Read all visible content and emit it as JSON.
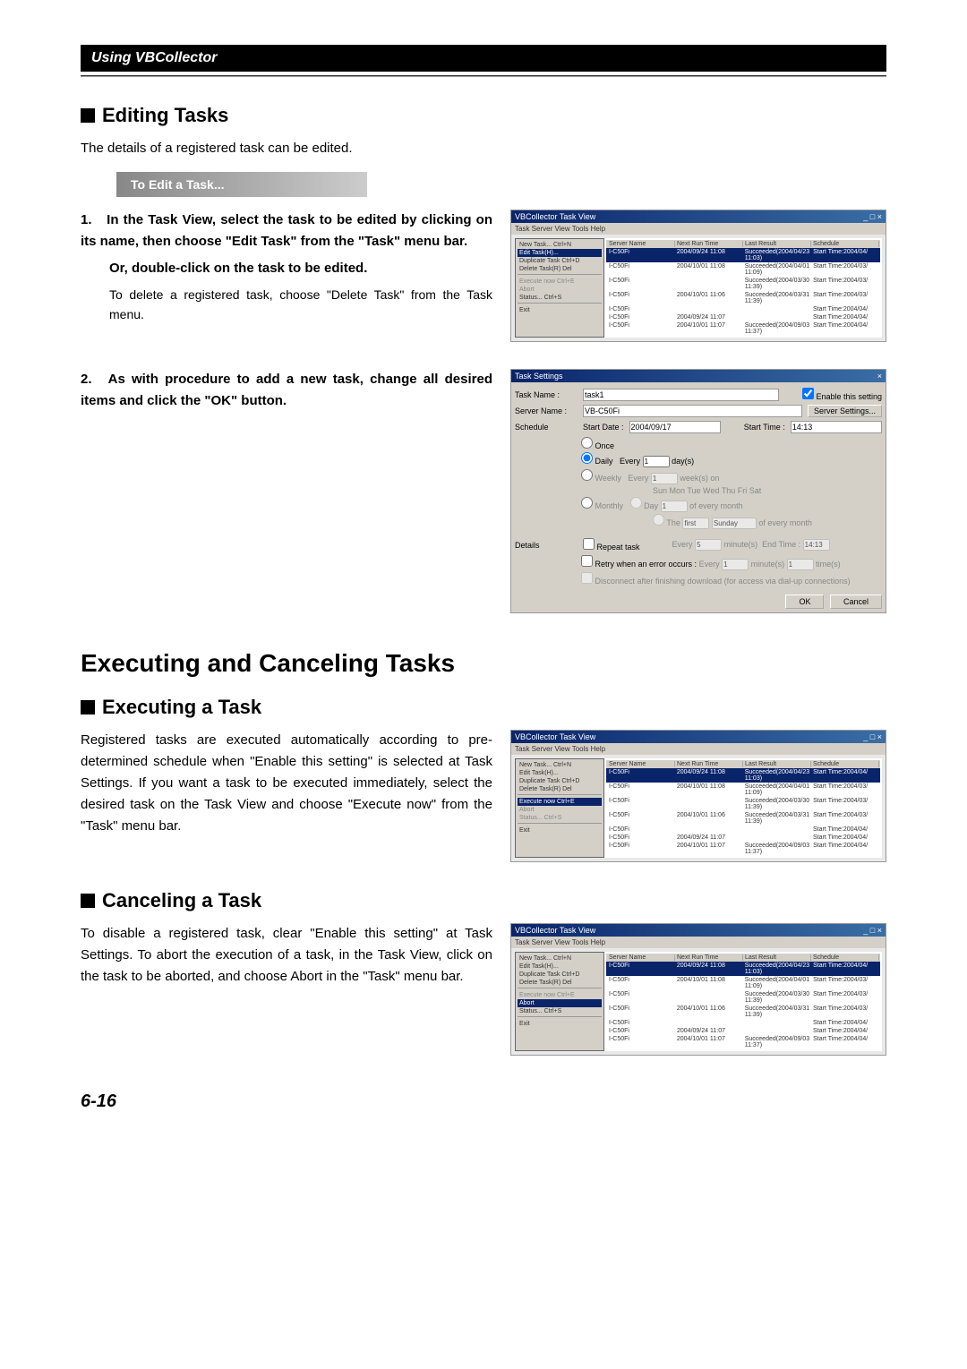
{
  "header": {
    "title": "Using VBCollector"
  },
  "editing": {
    "heading": "Editing Tasks",
    "intro": "The details of a registered task can be edited.",
    "sub_bar": "To Edit a Task...",
    "step1_text": "In the Task View, select the task to be edited by clicking on its name, then choose \"Edit Task\" from the \"Task\" menu bar.",
    "step1_sub": "Or, double-click on the task to be edited.",
    "step1_desc": "To delete a registered task, choose \"Delete Task\" from the Task menu.",
    "step2_text": "As with procedure to add a new task, change all desired items and click the \"OK\" button."
  },
  "exec_heading": "Executing and Canceling Tasks",
  "executing": {
    "heading": "Executing a Task",
    "body": "Registered tasks are executed automatically according to pre-determined schedule when \"Enable this setting\" is selected at Task Settings. If you want a task to be executed immediately, select the desired task on the Task View and choose \"Execute now\" from the \"Task\" menu bar."
  },
  "canceling": {
    "heading": "Canceling a Task",
    "body": "To disable a registered task, clear \"Enable this setting\" at Task Settings. To abort the execution of a task, in the Task View, click on the task to be aborted, and choose Abort in the \"Task\" menu bar."
  },
  "page_num": "6-16",
  "taskview": {
    "title": "VBCollector Task View",
    "menubar": "Task   Server   View   Tools   Help",
    "cols": {
      "server": "Server Name",
      "next": "Next Run Time",
      "last": "Last Result",
      "sched": "Schedule"
    },
    "menu": {
      "new": "New Task...        Ctrl+N",
      "edit": "Edit Task(H)...",
      "dup": "Duplicate Task   Ctrl+D",
      "del": "Delete Task(R)   Del",
      "exec": "Execute now    Ctrl+E",
      "abort": "Abort",
      "status": "Status...          Ctrl+S",
      "exit": "Exit"
    },
    "rows": [
      {
        "srv": "I-C50Fi",
        "next": "2004/09/24 11:08",
        "last": "Succeeded(2004/04/23 11:03)",
        "sched": "Start Time:2004/04/"
      },
      {
        "srv": "I-C50Fi",
        "next": "2004/10/01 11:08",
        "last": "Succeeded(2004/04/01 11:09)",
        "sched": "Start Time:2004/03/"
      },
      {
        "srv": "I-C50Fi",
        "next": "",
        "last": "Succeeded(2004/03/30 11:39)",
        "sched": "Start Time:2004/03/"
      },
      {
        "srv": "I-C50Fi",
        "next": "2004/10/01 11:06",
        "last": "Succeeded(2004/03/31 11:39)",
        "sched": "Start Time:2004/03/"
      },
      {
        "srv": "I-C50Fi",
        "next": "",
        "last": "",
        "sched": "Start Time:2004/04/"
      },
      {
        "srv": "I-C50Fi",
        "next": "2004/09/24 11:07",
        "last": "",
        "sched": "Start Time:2004/04/"
      },
      {
        "srv": "I-C50Fi",
        "next": "2004/10/01 11:07",
        "last": "Succeeded(2004/09/03 11:37)",
        "sched": "Start Time:2004/04/"
      }
    ]
  },
  "tasksettings": {
    "title": "Task Settings",
    "taskname_lbl": "Task Name :",
    "taskname_val": "task1",
    "enable_lbl": "Enable this setting",
    "server_lbl": "Server Name :",
    "server_val": "VB-C50Fi",
    "server_btn": "Server Settings...",
    "sched_lbl": "Schedule",
    "startdate_lbl": "Start Date :",
    "startdate_val": "2004/09/17",
    "starttime_lbl": "Start Time :",
    "starttime_val": "14:13",
    "once": "Once",
    "daily": "Daily",
    "daily_every": "Every",
    "daily_val": "1",
    "daily_unit": "day(s)",
    "weekly": "Weekly",
    "weekly_every": "Every",
    "weekly_val": "1",
    "weekly_unit": "week(s) on",
    "days": "Sun   Mon   Tue   Wed   Thu   Fri   Sat",
    "monthly": "Monthly",
    "monthly_day": "Day",
    "monthly_day_val": "1",
    "monthly_every": "of every month",
    "monthly_the": "The",
    "monthly_first": "first",
    "monthly_sunday": "Sunday",
    "details_lbl": "Details",
    "repeat": "Repeat task",
    "repeat_every": "Every",
    "repeat_val": "5",
    "repeat_unit": "minute(s)",
    "endtime_lbl": "End Time :",
    "endtime_val": "14:13",
    "retry": "Retry when an error occurs :",
    "retry_every": "Every",
    "retry_min": "1",
    "retry_min_unit": "minute(s)",
    "retry_times": "1",
    "retry_times_unit": "time(s)",
    "disconnect": "Disconnect after finishing download (for access via dial-up connections)",
    "ok": "OK",
    "cancel": "Cancel"
  }
}
